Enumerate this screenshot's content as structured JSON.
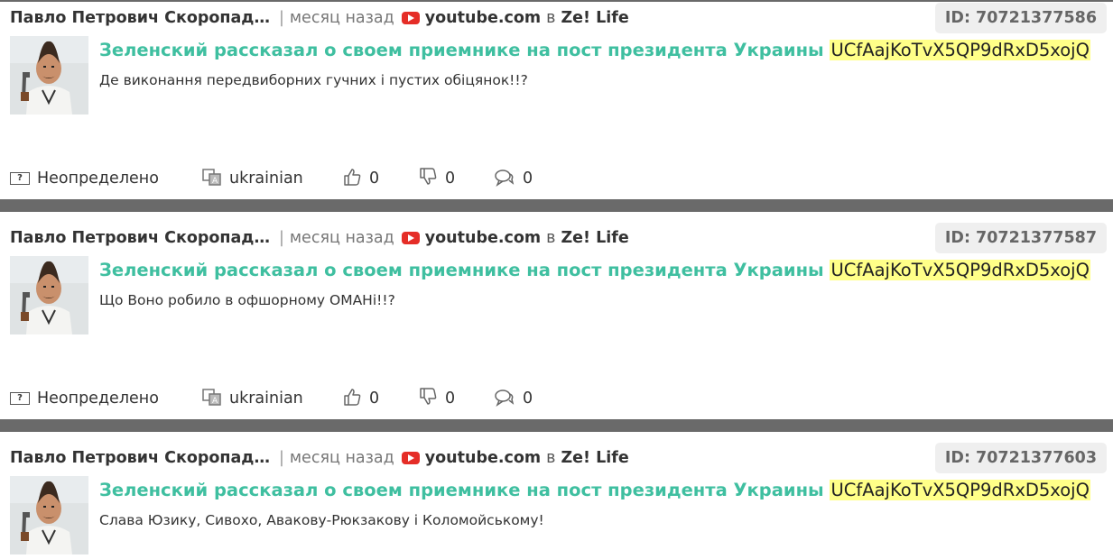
{
  "comments": [
    {
      "author": "Павло Петрович Скоропад…",
      "time": "месяц назад",
      "source": "youtube.com",
      "in_word": "в",
      "channel": "Ze! Life",
      "id_label": "ID: 70721377586",
      "title": "Зеленский рассказал о своем приемнике на пост президента Украины",
      "channel_code": "UCfAajKoTvX5QP9dRxD5xojQ",
      "text": "Де виконання передвиборних гучних і пустих обіцянок!!?",
      "sentiment": "Неопределено",
      "language": "ukrainian",
      "likes": "0",
      "dislikes": "0",
      "replies": "0"
    },
    {
      "author": "Павло Петрович Скоропад…",
      "time": "месяц назад",
      "source": "youtube.com",
      "in_word": "в",
      "channel": "Ze! Life",
      "id_label": "ID: 70721377587",
      "title": "Зеленский рассказал о своем приемнике на пост президента Украины",
      "channel_code": "UCfAajKoTvX5QP9dRxD5xojQ",
      "text": "Що Воно робило в офшорному ОМАНі!!?",
      "sentiment": "Неопределено",
      "language": "ukrainian",
      "likes": "0",
      "dislikes": "0",
      "replies": "0"
    },
    {
      "author": "Павло Петрович Скоропад…",
      "time": "месяц назад",
      "source": "youtube.com",
      "in_word": "в",
      "channel": "Ze! Life",
      "id_label": "ID: 70721377603",
      "title": "Зеленский рассказал о своем приемнике на пост президента Украины",
      "channel_code": "UCfAajKoTvX5QP9dRxD5xojQ",
      "text": "Слава Юзику, Сивохо, Авакову-Рюкзакову і Коломойському!"
    }
  ],
  "colors": {
    "title": "#3fbfa0",
    "highlight": "#ffff88",
    "separator": "#6a6a6a",
    "youtube": "#e52d27"
  },
  "icons": [
    "youtube-icon",
    "sentiment-unknown-icon",
    "language-icon",
    "thumb-up-icon",
    "thumb-down-icon",
    "comment-icon"
  ]
}
